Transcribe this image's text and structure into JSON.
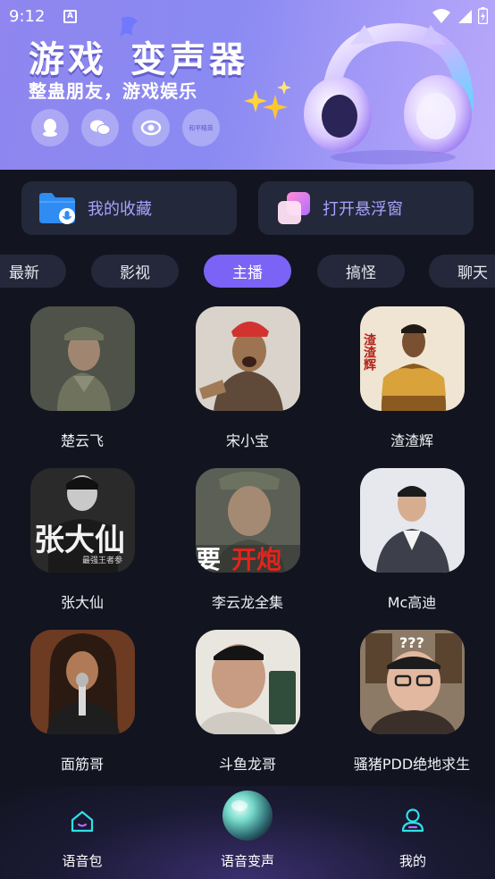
{
  "status_bar": {
    "time": "9:12",
    "notification_glyph": "A"
  },
  "banner": {
    "title_part1": "游戏",
    "title_part2": "变声器",
    "subtitle": "整蛊朋友，游戏娱乐",
    "social_icons": [
      "qq-icon",
      "wechat-icon",
      "eye-icon",
      "hepingjingying-icon"
    ],
    "social_small_text": "和平精英"
  },
  "features": [
    {
      "label": "我的收藏",
      "icon": "folder-mic-icon"
    },
    {
      "label": "打开悬浮窗",
      "icon": "floating-window-icon"
    }
  ],
  "tabs": [
    "最新",
    "影视",
    "主播",
    "搞怪",
    "聊天"
  ],
  "active_tab": "主播",
  "voices": [
    {
      "name": "楚云飞"
    },
    {
      "name": "宋小宝"
    },
    {
      "name": "渣渣辉"
    },
    {
      "name": "张大仙"
    },
    {
      "name": "李云龙全集"
    },
    {
      "name": "Mc高迪"
    },
    {
      "name": "面筋哥"
    },
    {
      "name": "斗鱼龙哥"
    },
    {
      "name": "骚猪PDD绝地求生"
    }
  ],
  "avatar_text": {
    "zhazhahui_side": "渣渣辉",
    "zhangdaxian_big": "张大仙",
    "zhangdaxian_small": "最强王者参",
    "liyunlong_caption_white": "要",
    "liyunlong_caption_red": "开炮"
  },
  "bottom_nav": [
    {
      "label": "语音包",
      "icon": "home-icon"
    },
    {
      "label": "语音变声",
      "icon": "orb-icon"
    },
    {
      "label": "我的",
      "icon": "user-icon"
    }
  ],
  "colors": {
    "accent": "#7b63f5",
    "background": "#121420",
    "card": "#23283a",
    "feature_text": "#a7a3ff"
  }
}
